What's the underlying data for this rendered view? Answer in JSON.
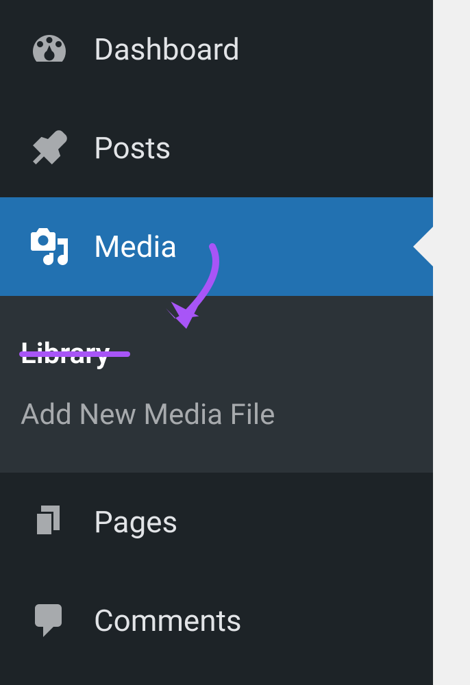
{
  "sidebar": {
    "items": [
      {
        "label": "Dashboard",
        "icon": "dashboard"
      },
      {
        "label": "Posts",
        "icon": "pin"
      },
      {
        "label": "Media",
        "icon": "media",
        "active": true
      },
      {
        "label": "Pages",
        "icon": "pages"
      },
      {
        "label": "Comments",
        "icon": "comments"
      }
    ],
    "submenu": [
      {
        "label": "Library",
        "current": true
      },
      {
        "label": "Add New Media File"
      }
    ]
  }
}
